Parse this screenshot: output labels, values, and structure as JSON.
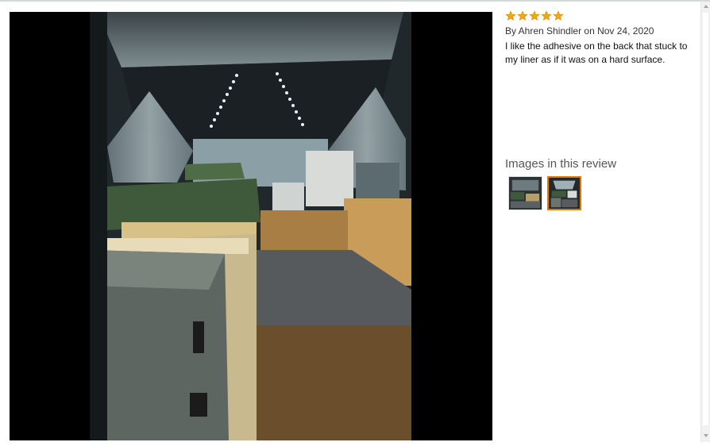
{
  "review": {
    "rating": 5,
    "byline": "By Ahren Shindler on Nov 24, 2020",
    "text": "I like the adhesive on the back that stuck to my liner as if it was on a hard surface."
  },
  "images_section": {
    "heading": "Images in this review",
    "thumbnails": [
      {
        "selected": false
      },
      {
        "selected": true
      }
    ]
  },
  "colors": {
    "star": "#f1a90f",
    "selected_border": "#e77600"
  }
}
